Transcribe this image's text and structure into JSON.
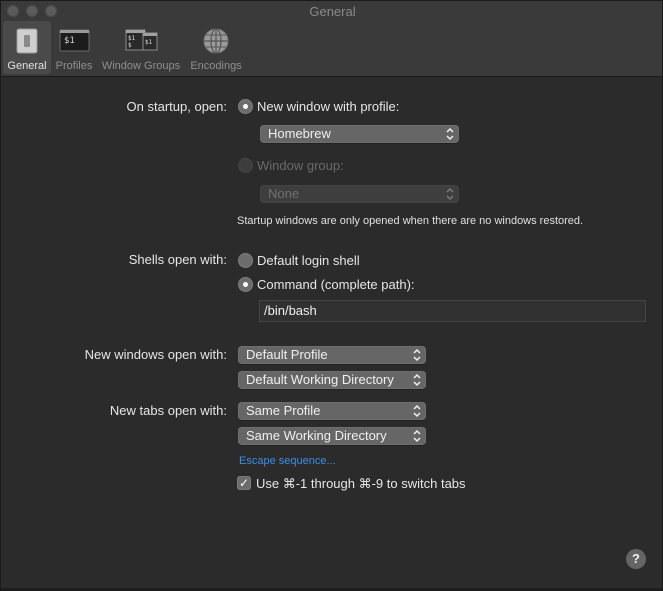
{
  "window": {
    "title": "General"
  },
  "toolbar": {
    "items": [
      {
        "label": "General",
        "icon": "switch-icon",
        "active": true
      },
      {
        "label": "Profiles",
        "icon": "terminal-icon"
      },
      {
        "label": "Window Groups",
        "icon": "window-groups-icon"
      },
      {
        "label": "Encodings",
        "icon": "globe-icon"
      }
    ]
  },
  "startup": {
    "label": "On startup, open:",
    "option_profile": "New window with profile:",
    "profile_value": "Homebrew",
    "option_group": "Window group:",
    "group_value": "None",
    "note": "Startup windows are only opened when there are no windows restored."
  },
  "shells": {
    "label": "Shells open with:",
    "option_default": "Default login shell",
    "option_command": "Command (complete path):",
    "command_value": "/bin/bash"
  },
  "new_windows": {
    "label": "New windows open with:",
    "profile_value": "Default Profile",
    "directory_value": "Default Working Directory"
  },
  "new_tabs": {
    "label": "New tabs open with:",
    "profile_value": "Same Profile",
    "directory_value": "Same Working Directory"
  },
  "escape_link": "Escape sequence...",
  "switch_tabs": {
    "label": "Use ⌘-1 through ⌘-9 to switch tabs",
    "checked": true
  },
  "help_label": "?"
}
